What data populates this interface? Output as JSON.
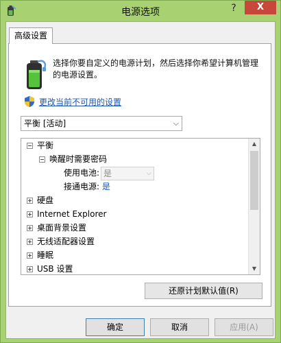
{
  "window": {
    "title": "电源选项",
    "help_glyph": "?",
    "close_glyph": "X"
  },
  "tab": {
    "label": "高级设置"
  },
  "description": {
    "line1": "选择你要自定义的电源计划，然后选择你希望计算机管理",
    "line2": "的电源设置。"
  },
  "link": {
    "label": "更改当前不可用的设置"
  },
  "plan_select": {
    "value": "平衡 [活动]",
    "arrow": "⌵"
  },
  "tree": {
    "root": {
      "label": "平衡"
    },
    "child": {
      "label": "唤醒时需要密码"
    },
    "on_battery": {
      "label": "使用电池:",
      "value": "是",
      "arrow": "⌵"
    },
    "plugged_in": {
      "label": "接通电源:",
      "value": "是"
    },
    "items": [
      {
        "label": "硬盘"
      },
      {
        "label": "Internet Explorer"
      },
      {
        "label": "桌面背景设置"
      },
      {
        "label": "无线适配器设置"
      },
      {
        "label": "睡眠"
      },
      {
        "label": "USB 设置"
      }
    ],
    "scroll_up": "▲",
    "scroll_down": "▼"
  },
  "buttons": {
    "restore": "还原计划默认值(R)",
    "ok": "确定",
    "cancel": "取消",
    "apply": "应用(A)"
  },
  "colors": {
    "frame": "#a8d172",
    "close": "#c7473a",
    "link": "#1a56b0"
  }
}
